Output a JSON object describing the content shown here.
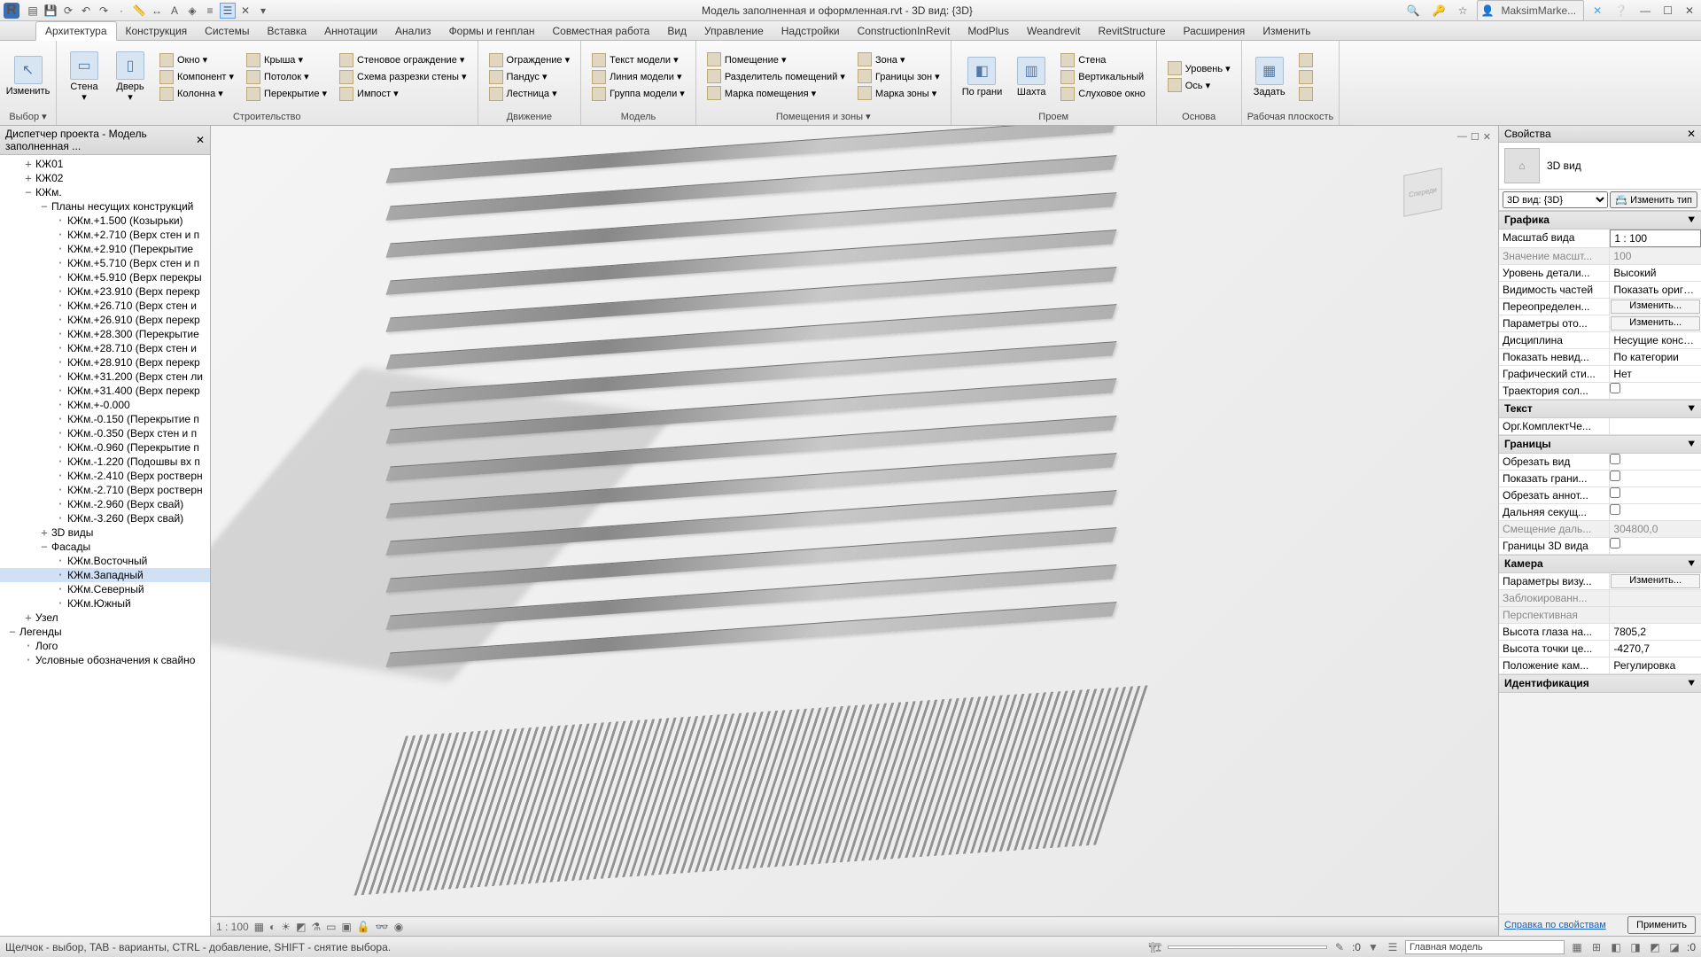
{
  "title": "Модель заполненная и оформленная.rvt - 3D вид: {3D}",
  "user": "MaksimMarke...",
  "ribbon_tabs": [
    "Архитектура",
    "Конструкция",
    "Системы",
    "Вставка",
    "Аннотации",
    "Анализ",
    "Формы и генплан",
    "Совместная работа",
    "Вид",
    "Управление",
    "Надстройки",
    "ConstructionInRevit",
    "ModPlus",
    "Weandrevit",
    "RevitStructure",
    "Расширения",
    "Изменить"
  ],
  "ribbon_active": 0,
  "ribbon_groups": {
    "select": {
      "btn": "Изменить",
      "label": "Выбор ▾"
    },
    "build": {
      "label": "Строительство",
      "large": [
        {
          "lbl": "Стена",
          "ico": "▭"
        },
        {
          "lbl": "Дверь",
          "ico": "▯"
        }
      ],
      "cols": [
        [
          "Окно",
          "Компонент",
          "Колонна"
        ],
        [
          "Крыша",
          "Потолок",
          "Перекрытие"
        ],
        [
          "Стеновое ограждение",
          "Схема разрезки стены",
          "Импост"
        ]
      ]
    },
    "circ": {
      "label": "Движение",
      "items": [
        "Ограждение",
        "Пандус",
        "Лестница"
      ]
    },
    "model": {
      "label": "Модель",
      "items": [
        "Текст модели",
        "Линия модели",
        "Группа модели"
      ]
    },
    "rooms": {
      "label": "Помещения и зоны ▾",
      "cols": [
        [
          "Помещение",
          "Разделитель помещений",
          "Марка помещения"
        ],
        [
          "Зона",
          "Границы зон",
          "Марка зоны"
        ]
      ]
    },
    "open": {
      "label": "Проем",
      "large": [
        {
          "lbl": "По грани",
          "ico": "◧"
        },
        {
          "lbl": "Шахта",
          "ico": "▥"
        }
      ],
      "items": [
        "Стена",
        "Вертикальный",
        "Слуховое окно"
      ]
    },
    "datum": {
      "label": "Основа",
      "items": [
        "Уровень",
        "Ось"
      ]
    },
    "wp": {
      "label": "Рабочая плоскость",
      "btn": "Задать"
    }
  },
  "project_browser": {
    "title": "Диспетчер проекта - Модель заполненная ...",
    "items": [
      {
        "d": 1,
        "exp": "+",
        "t": "КЖ01"
      },
      {
        "d": 1,
        "exp": "+",
        "t": "КЖ02"
      },
      {
        "d": 1,
        "exp": "−",
        "t": "КЖм."
      },
      {
        "d": 2,
        "exp": "−",
        "t": "Планы несущих конструкций"
      },
      {
        "d": 3,
        "t": "КЖм.+1.500 (Козырьки)"
      },
      {
        "d": 3,
        "t": "КЖм.+2.710 (Верх стен и п"
      },
      {
        "d": 3,
        "t": "КЖм.+2.910 (Перекрытие"
      },
      {
        "d": 3,
        "t": "КЖм.+5.710 (Верх стен и п"
      },
      {
        "d": 3,
        "t": "КЖм.+5.910 (Верх перекры"
      },
      {
        "d": 3,
        "t": "КЖм.+23.910 (Верх перекр"
      },
      {
        "d": 3,
        "t": "КЖм.+26.710 (Верх стен и"
      },
      {
        "d": 3,
        "t": "КЖм.+26.910 (Верх перекр"
      },
      {
        "d": 3,
        "t": "КЖм.+28.300 (Перекрытие"
      },
      {
        "d": 3,
        "t": "КЖм.+28.710 (Верх стен и"
      },
      {
        "d": 3,
        "t": "КЖм.+28.910 (Верх перекр"
      },
      {
        "d": 3,
        "t": "КЖм.+31.200 (Верх стен ли"
      },
      {
        "d": 3,
        "t": "КЖм.+31.400 (Верх перекр"
      },
      {
        "d": 3,
        "t": "КЖм.+-0.000"
      },
      {
        "d": 3,
        "t": "КЖм.-0.150 (Перекрытие п"
      },
      {
        "d": 3,
        "t": "КЖм.-0.350 (Верх стен и п"
      },
      {
        "d": 3,
        "t": "КЖм.-0.960 (Перекрытие п"
      },
      {
        "d": 3,
        "t": "КЖм.-1.220 (Подошвы вх п"
      },
      {
        "d": 3,
        "t": "КЖм.-2.410 (Верх ростверн"
      },
      {
        "d": 3,
        "t": "КЖм.-2.710 (Верх ростверн"
      },
      {
        "d": 3,
        "t": "КЖм.-2.960 (Верх свай)"
      },
      {
        "d": 3,
        "t": "КЖм.-3.260 (Верх свай)"
      },
      {
        "d": 2,
        "exp": "+",
        "t": "3D виды"
      },
      {
        "d": 2,
        "exp": "−",
        "t": "Фасады"
      },
      {
        "d": 3,
        "t": "КЖм.Восточный"
      },
      {
        "d": 3,
        "t": "КЖм.Западный",
        "sel": true
      },
      {
        "d": 3,
        "t": "КЖм.Северный"
      },
      {
        "d": 3,
        "t": "КЖм.Южный"
      },
      {
        "d": 1,
        "exp": "+",
        "t": "Узел"
      },
      {
        "d": 0,
        "exp": "−",
        "t": "Легенды"
      },
      {
        "d": 1,
        "t": "Лого"
      },
      {
        "d": 1,
        "t": "Условные обозначения к свайно"
      }
    ]
  },
  "viewport": {
    "scale": "1 : 100"
  },
  "properties": {
    "title": "Свойства",
    "type_name": "3D вид",
    "selector": "3D вид: {3D}",
    "edit_type": "📇 Изменить тип",
    "cats": [
      {
        "name": "Графика",
        "rows": [
          {
            "l": "Масштаб вида",
            "v": "1 : 100",
            "box": true
          },
          {
            "l": "Значение масшт...",
            "v": "100",
            "dim": true
          },
          {
            "l": "Уровень детали...",
            "v": "Высокий"
          },
          {
            "l": "Видимость частей",
            "v": "Показать ориги..."
          },
          {
            "l": "Переопределен...",
            "btn": "Изменить..."
          },
          {
            "l": "Параметры ото...",
            "btn": "Изменить..."
          },
          {
            "l": "Дисциплина",
            "v": "Несущие констру..."
          },
          {
            "l": "Показать невид...",
            "v": "По категории"
          },
          {
            "l": "Графический сти...",
            "v": "Нет"
          },
          {
            "l": "Траектория сол...",
            "cb": false
          }
        ]
      },
      {
        "name": "Текст",
        "rows": [
          {
            "l": "Орг.КомплектЧе...",
            "v": ""
          }
        ]
      },
      {
        "name": "Границы",
        "rows": [
          {
            "l": "Обрезать вид",
            "cb": false
          },
          {
            "l": "Показать грани...",
            "cb": false
          },
          {
            "l": "Обрезать аннот...",
            "cb": false
          },
          {
            "l": "Дальняя секущ...",
            "cb": false
          },
          {
            "l": "Смещение даль...",
            "v": "304800,0",
            "dim": true
          },
          {
            "l": "Границы 3D вида",
            "cb": false
          }
        ]
      },
      {
        "name": "Камера",
        "rows": [
          {
            "l": "Параметры визу...",
            "btn": "Изменить..."
          },
          {
            "l": "Заблокированн...",
            "v": "",
            "dim": true
          },
          {
            "l": "Перспективная",
            "v": "",
            "dim": true
          },
          {
            "l": "Высота глаза на...",
            "v": "7805,2"
          },
          {
            "l": "Высота точки це...",
            "v": "-4270,7"
          },
          {
            "l": "Положение кам...",
            "v": "Регулировка"
          }
        ]
      },
      {
        "name": "Идентификация",
        "rows": []
      }
    ],
    "help": "Справка по свойствам",
    "apply": "Применить"
  },
  "statusbar": {
    "hint": "Щелчок - выбор, TAB - варианты, CTRL - добавление, SHIFT - снятие выбора.",
    "sel": ":0",
    "worksets": "Главная модель"
  }
}
